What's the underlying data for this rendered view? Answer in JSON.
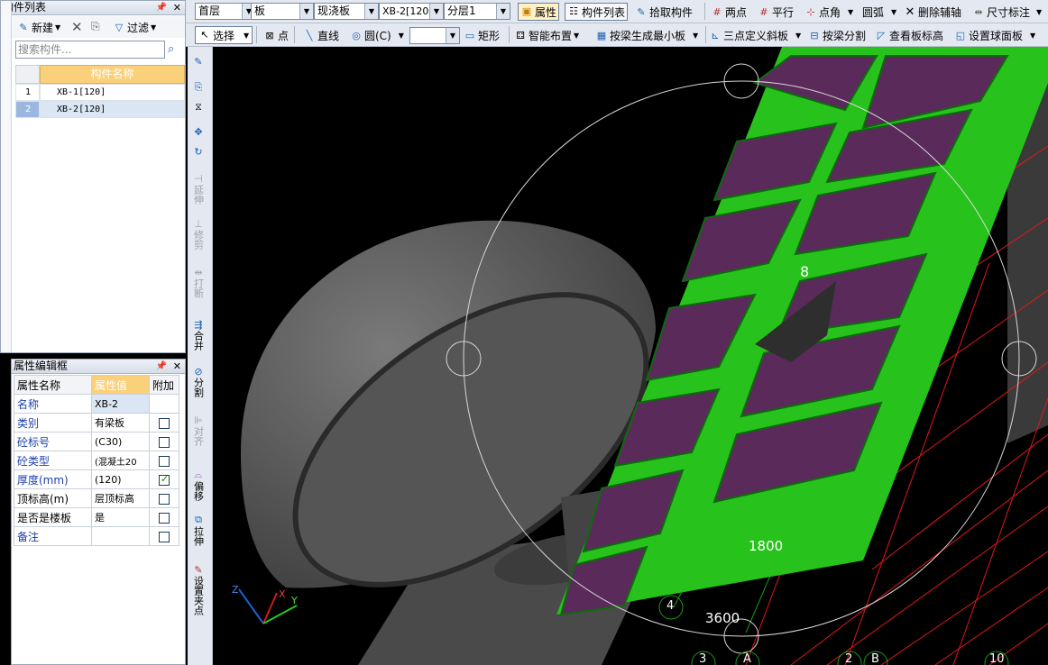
{
  "component_list": {
    "title": "构件列表",
    "new_label": "新建",
    "filter_label": "过滤",
    "search_placeholder": "搜索构件...",
    "column_header": "构件名称",
    "rows": [
      {
        "index": "1",
        "name": "XB-1[120]"
      },
      {
        "index": "2",
        "name": "XB-2[120]"
      }
    ]
  },
  "property_editor": {
    "title": "属性编辑框",
    "headers": [
      "属性名称",
      "属性值",
      "附加"
    ],
    "rows": [
      {
        "name": "名称",
        "value": "XB-2",
        "checked": null
      },
      {
        "name": "类别",
        "value": "有梁板",
        "checked": false
      },
      {
        "name": "砼标号",
        "value": "(C30)",
        "checked": false
      },
      {
        "name": "砼类型",
        "value": "(混凝土20",
        "checked": false
      },
      {
        "name": "厚度(mm)",
        "value": "(120)",
        "checked": true
      },
      {
        "name": "顶标高(m)",
        "value": "层顶标高",
        "checked": false
      },
      {
        "name": "是否是楼板",
        "value": "是",
        "checked": false
      },
      {
        "name": "备注",
        "value": "",
        "checked": false
      }
    ]
  },
  "toolbar1": {
    "floor": "首层",
    "type": "板",
    "subtype": "现浇板",
    "component": "XB-2[120]",
    "layer": "分层1",
    "properties": "属性",
    "component_list": "构件列表",
    "pick_component": "拾取构件",
    "two_points": "两点",
    "parallel": "平行",
    "point_angle": "点角",
    "arc": "圆弧",
    "delete_aux": "删除辅轴",
    "dimension": "尺寸标注"
  },
  "toolbar2": {
    "select": "选择",
    "point": "点",
    "line": "直线",
    "circle": "圆(C)",
    "empty_select": "",
    "rect": "矩形",
    "smart_layout": "智能布置",
    "beam_min_slab": "按梁生成最小板",
    "three_point_slope": "三点定义斜板",
    "beam_split": "按梁分割",
    "view_elevation": "查看板标高",
    "set_sphere": "设置球面板"
  },
  "left_tools": {
    "extend": "延伸",
    "trim": "修剪",
    "break": "打断",
    "merge": "合并",
    "split": "分割",
    "align": "对齐",
    "offset": "偏移",
    "stretch": "拉伸",
    "set_grip": "设置夹点"
  },
  "viewport": {
    "dim1": "1800",
    "dim2": "3600",
    "dim3": "8",
    "axis_4": "4",
    "axis_3": "3",
    "axis_a": "A",
    "axis_2": "2",
    "axis_b": "B",
    "axis_10": "10",
    "axis_x": "X",
    "axis_y": "Y",
    "axis_z": "Z",
    "colors": {
      "slab_frame": "#27c21b",
      "slab_panel": "#5a2a5a",
      "grid": "#e01818",
      "green_grid": "#1a9a1a"
    }
  }
}
